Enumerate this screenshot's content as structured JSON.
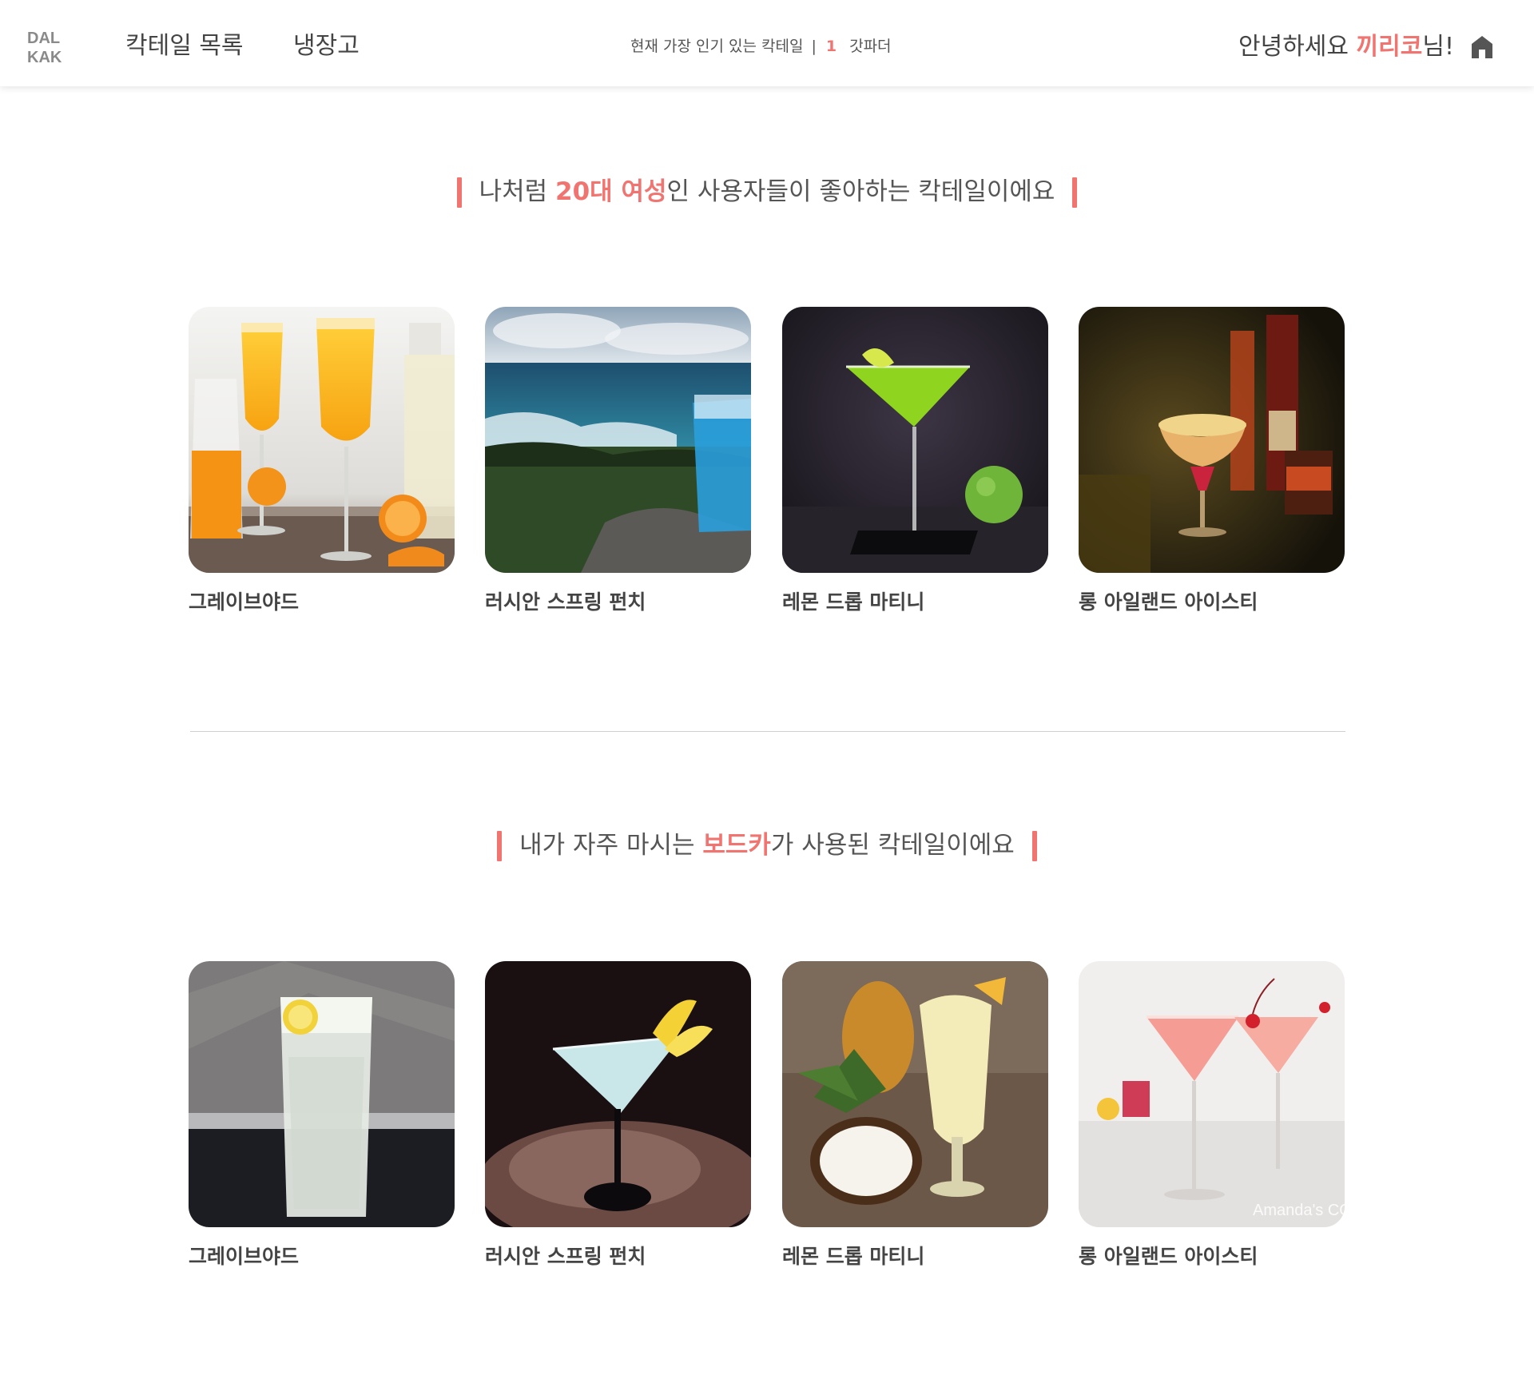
{
  "header": {
    "logo": [
      "DAL",
      "KAK"
    ],
    "nav": [
      "칵테일 목록",
      "냉장고"
    ],
    "popular": {
      "label": "현재 가장 인기 있는 칵테일",
      "separator": "|",
      "rank": "1",
      "name": "갓파더"
    },
    "greeting": {
      "prefix": "안녕하세요 ",
      "user": "끼리코",
      "suffix": "님!"
    },
    "home_icon": "home-icon"
  },
  "sections": [
    {
      "title": {
        "prefix": "나처럼 ",
        "highlight": "20대 여성",
        "suffix": "인 사용자들이 좋아하는 칵테일이에요"
      },
      "cards": [
        {
          "name": "그레이브야드",
          "image": "orange-champagne-cocktails-photo"
        },
        {
          "name": "러시안 스프링 펀치",
          "image": "blue-cocktail-seaside-photo"
        },
        {
          "name": "레몬 드롭 마티니",
          "image": "green-apple-martini-photo"
        },
        {
          "name": "롱 아일랜드 아이스티",
          "image": "tropical-cocktail-bar-photo"
        }
      ]
    },
    {
      "title": {
        "prefix": "내가 자주 마시는 ",
        "highlight": "보드카",
        "suffix": "가 사용된 칵테일이에요"
      },
      "cards": [
        {
          "name": "그레이브야드",
          "image": "lemon-highball-photo"
        },
        {
          "name": "러시안 스프링 펀치",
          "image": "lemon-twist-martini-photo"
        },
        {
          "name": "레몬 드롭 마티니",
          "image": "pina-colada-photo"
        },
        {
          "name": "롱 아일랜드 아이스티",
          "image": "pink-cosmopolitan-photo",
          "watermark": "Amanda's COOKIN"
        }
      ]
    }
  ],
  "colors": {
    "accent": "#f07470",
    "text": "#555555",
    "divider": "#cfcfcf"
  }
}
